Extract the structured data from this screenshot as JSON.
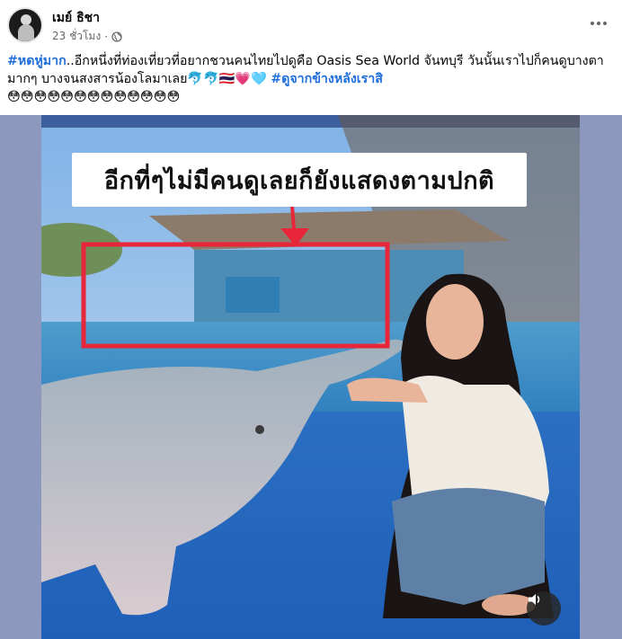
{
  "post": {
    "author": "เมย์ ธิชา",
    "time": "23 ชั่วโมง",
    "separator": "·",
    "text": {
      "hashtag1": "#หดหู่มาก",
      "line1_rest": "..อีกหนึ่งที่ท่องเที่ยวที่อยากชวนคนไทยไปดูคือ Oasis Sea World จันทบุรี วันนั้นเราไปก็คนดูบางตา",
      "line2_start": "มากๆ บางจนสงสารน้องโลมาเลย",
      "line2_emoji": "🐬🐬🇹🇭💗🩵",
      "hashtag2": "#ดูจากข้างหลังเราสิ",
      "line3_emoji": "😳😳😳😳😳😳😳😳😳😳😳😳😳"
    }
  },
  "media": {
    "overlay_caption": "อีกที่ๆไม่มีคนดูเลยก็ยังแสดงตามปกติ",
    "highlight_color": "#e8263a",
    "sound_icon": "speaker-icon"
  },
  "colors": {
    "hashtag": "#216fdb",
    "meta": "#65676b",
    "media_bg": "#8d98bf"
  }
}
